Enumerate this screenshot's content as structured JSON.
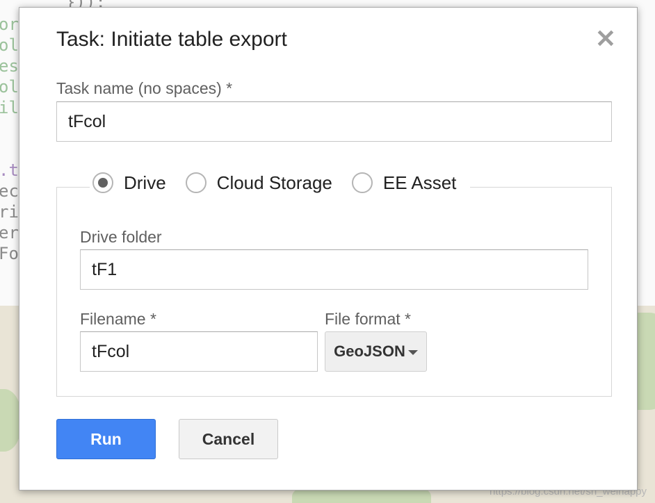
{
  "dialog": {
    "title": "Task: Initiate table export",
    "close_glyph": "✕",
    "task_name": {
      "label": "Task name (no spaces) *",
      "value": "tFcol"
    },
    "destination": {
      "options": [
        {
          "label": "Drive",
          "selected": true
        },
        {
          "label": "Cloud Storage",
          "selected": false
        },
        {
          "label": "EE Asset",
          "selected": false
        }
      ]
    },
    "drive_folder": {
      "label": "Drive folder",
      "value": "tF1"
    },
    "filename": {
      "label": "Filename *",
      "value": "tFcol"
    },
    "file_format": {
      "label": "File format *",
      "value": "GeoJSON"
    },
    "buttons": {
      "run": "Run",
      "cancel": "Cancel"
    }
  },
  "watermark": "https://blog.csdn.net/sh_weihappy",
  "colors": {
    "primary_button": "#4285f4",
    "title_text": "#212121",
    "label_text": "#5f5f5f"
  }
}
